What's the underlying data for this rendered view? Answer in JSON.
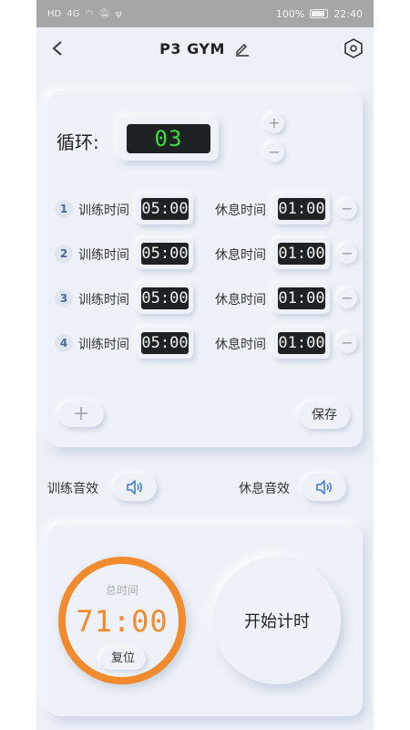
{
  "status_bar": {
    "left_glyphs": [
      "HD",
      "4G",
      "wifi",
      "mute",
      "usb"
    ],
    "battery_text": "100%",
    "time": "22:40"
  },
  "header": {
    "title": "P3 GYM"
  },
  "cycle": {
    "label": "循环:",
    "value": "03",
    "plus": "+",
    "minus": "−"
  },
  "rounds": [
    {
      "index": "1",
      "train_label": "训练时间",
      "train_time": "05:00",
      "rest_label": "休息时间",
      "rest_time": "01:00"
    },
    {
      "index": "2",
      "train_label": "训练时间",
      "train_time": "05:00",
      "rest_label": "休息时间",
      "rest_time": "01:00"
    },
    {
      "index": "3",
      "train_label": "训练时间",
      "train_time": "05:00",
      "rest_label": "休息时间",
      "rest_time": "01:00"
    },
    {
      "index": "4",
      "train_label": "训练时间",
      "train_time": "05:00",
      "rest_label": "休息时间",
      "rest_time": "01:00"
    }
  ],
  "row_minus": "−",
  "add_label": "+",
  "save_label": "保存",
  "sound": {
    "train_label": "训练音效",
    "rest_label": "休息音效"
  },
  "timer": {
    "total_label": "总时间",
    "total_value": "71:00",
    "reset_label": "复位",
    "start_label": "开始计时"
  },
  "colors": {
    "accent_orange": "#f28a2e",
    "digit_green": "#3ddc3d",
    "icon_blue": "#3b7de0"
  }
}
